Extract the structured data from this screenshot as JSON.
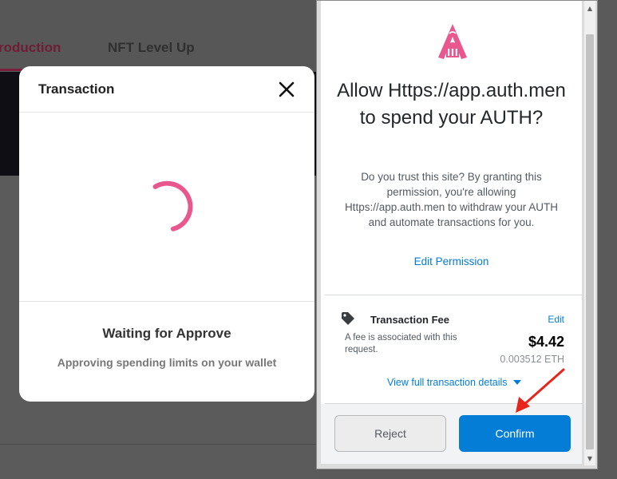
{
  "background": {
    "tabs": [
      {
        "label": "roduction",
        "active": true
      },
      {
        "label": "NFT Level Up",
        "active": false
      }
    ]
  },
  "transaction_modal": {
    "title": "Transaction",
    "status_title": "Waiting for Approve",
    "status_subtitle": "Approving spending limits on your wallet",
    "spinner_color": "#e8588f"
  },
  "wallet_popup": {
    "heading": "Allow Https://app.auth.men to spend your AUTH?",
    "description": "Do you trust this site? By granting this permission, you're allowing Https://app.auth.men to withdraw your AUTH and automate transactions for you.",
    "edit_permission": "Edit Permission",
    "fee": {
      "label": "Transaction Fee",
      "edit": "Edit",
      "note": "A fee is associated with this request.",
      "usd": "$4.42",
      "eth": "0.003512 ETH"
    },
    "view_details": "View full transaction details",
    "reject": "Reject",
    "confirm": "Confirm",
    "accent_color": "#037dd6",
    "logo_color": "#e8588f"
  }
}
